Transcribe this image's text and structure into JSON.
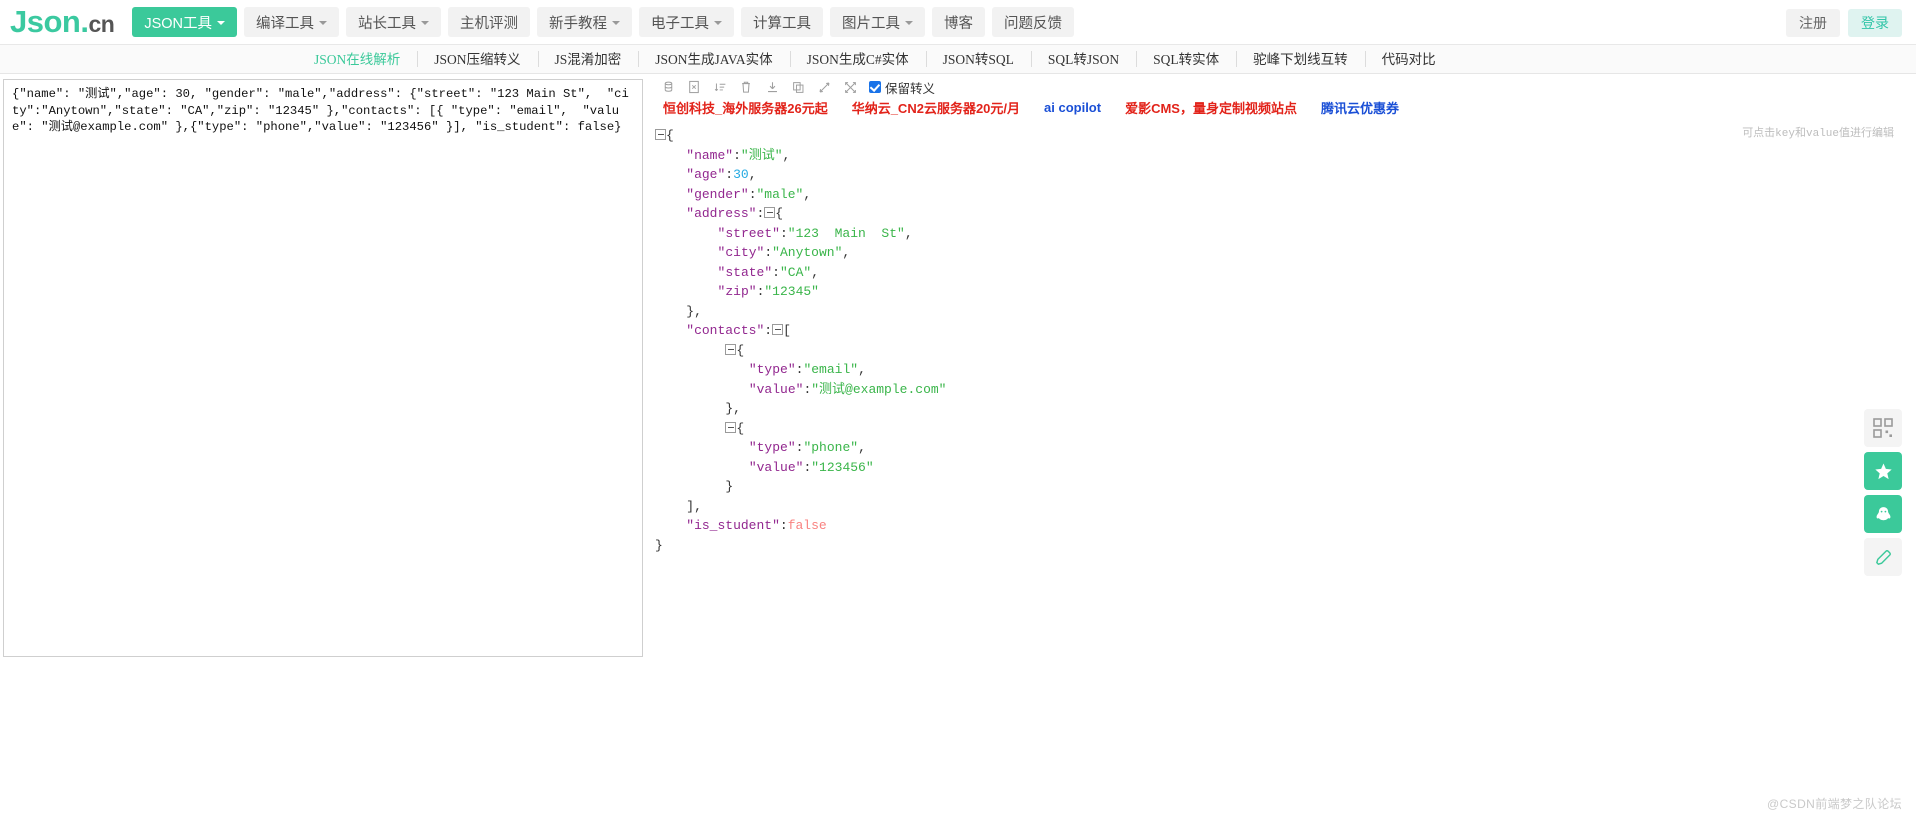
{
  "header": {
    "logo": {
      "json": "Json",
      "dot": ".",
      "cn": "cn"
    },
    "nav_items": [
      {
        "label": "JSON工具",
        "caret": true,
        "active": true
      },
      {
        "label": "编译工具",
        "caret": true,
        "active": false
      },
      {
        "label": "站长工具",
        "caret": true,
        "active": false
      },
      {
        "label": "主机评测",
        "caret": false,
        "active": false
      },
      {
        "label": "新手教程",
        "caret": true,
        "active": false
      },
      {
        "label": "电子工具",
        "caret": true,
        "active": false
      },
      {
        "label": "计算工具",
        "caret": false,
        "active": false
      },
      {
        "label": "图片工具",
        "caret": true,
        "active": false
      },
      {
        "label": "博客",
        "caret": false,
        "active": false
      },
      {
        "label": "问题反馈",
        "caret": false,
        "active": false
      }
    ],
    "register_label": "注册",
    "login_label": "登录"
  },
  "subnav": {
    "items": [
      {
        "label": "JSON在线解析",
        "active": true
      },
      {
        "label": "JSON压缩转义",
        "active": false
      },
      {
        "label": "JS混淆加密",
        "active": false
      },
      {
        "label": "JSON生成JAVA实体",
        "active": false
      },
      {
        "label": "JSON生成C#实体",
        "active": false
      },
      {
        "label": "JSON转SQL",
        "active": false
      },
      {
        "label": "SQL转JSON",
        "active": false
      },
      {
        "label": "SQL转实体",
        "active": false
      },
      {
        "label": "驼峰下划线互转",
        "active": false
      },
      {
        "label": "代码对比",
        "active": false
      }
    ]
  },
  "editor": {
    "value": "{\"name\": \"测试\",\"age\": 30, \"gender\": \"male\",\"address\": {\"street\": \"123 Main St\",  \"city\":\"Anytown\",\"state\": \"CA\",\"zip\": \"12345\" },\"contacts\": [{ \"type\": \"email\",  \"value\": \"测试@example.com\" },{\"type\": \"phone\",\"value\": \"123456\" }], \"is_student\": false}",
    "placeholder": ""
  },
  "toolbar": {
    "icons": [
      {
        "name": "format-icon",
        "title": "格式化"
      },
      {
        "name": "document-icon",
        "title": "校验"
      },
      {
        "name": "sort-icon",
        "title": "排序"
      },
      {
        "name": "delete-icon",
        "title": "清空"
      },
      {
        "name": "download-icon",
        "title": "下载"
      },
      {
        "name": "copy-icon",
        "title": "复制"
      },
      {
        "name": "collapse-icon",
        "title": "折叠"
      },
      {
        "name": "expand-icon",
        "title": "展开"
      }
    ],
    "checkbox_label": "保留转义",
    "checkbox_checked": true
  },
  "ads": {
    "links": [
      {
        "text": "恒创科技_海外服务器26元起",
        "color": "#e2231a"
      },
      {
        "text": "华纳云_CN2云服务器20元/月",
        "color": "#e2231a"
      },
      {
        "text": "ai copilot",
        "color": "#1a4fd6"
      },
      {
        "text": "爱影CMS，量身定制视频站点",
        "color": "#e2231a"
      },
      {
        "text": "腾讯云优惠券",
        "color": "#1a4fd6"
      }
    ]
  },
  "tree": {
    "hint": "可点击key和value值进行编辑",
    "lines": [
      {
        "indent": 0,
        "toggle": true,
        "parts": [
          {
            "t": "{",
            "c": "p"
          }
        ]
      },
      {
        "indent": 4,
        "toggle": false,
        "parts": [
          {
            "t": "\"name\"",
            "c": "k"
          },
          {
            "t": ":",
            "c": "p"
          },
          {
            "t": "\"测试\"",
            "c": "s"
          },
          {
            "t": ",",
            "c": "p"
          }
        ]
      },
      {
        "indent": 4,
        "toggle": false,
        "parts": [
          {
            "t": "\"age\"",
            "c": "k"
          },
          {
            "t": ":",
            "c": "p"
          },
          {
            "t": "30",
            "c": "n"
          },
          {
            "t": ",",
            "c": "p"
          }
        ]
      },
      {
        "indent": 4,
        "toggle": false,
        "parts": [
          {
            "t": "\"gender\"",
            "c": "k"
          },
          {
            "t": ":",
            "c": "p"
          },
          {
            "t": "\"male\"",
            "c": "s"
          },
          {
            "t": ",",
            "c": "p"
          }
        ]
      },
      {
        "indent": 4,
        "toggle": true,
        "toggleAfter": true,
        "parts": [
          {
            "t": "\"address\"",
            "c": "k"
          },
          {
            "t": ":",
            "c": "p"
          }
        ],
        "tail": "{"
      },
      {
        "indent": 8,
        "toggle": false,
        "parts": [
          {
            "t": "\"street\"",
            "c": "k"
          },
          {
            "t": ":",
            "c": "p"
          },
          {
            "t": "\"123  Main  St\"",
            "c": "s"
          },
          {
            "t": ",",
            "c": "p"
          }
        ]
      },
      {
        "indent": 8,
        "toggle": false,
        "parts": [
          {
            "t": "\"city\"",
            "c": "k"
          },
          {
            "t": ":",
            "c": "p"
          },
          {
            "t": "\"Anytown\"",
            "c": "s"
          },
          {
            "t": ",",
            "c": "p"
          }
        ]
      },
      {
        "indent": 8,
        "toggle": false,
        "parts": [
          {
            "t": "\"state\"",
            "c": "k"
          },
          {
            "t": ":",
            "c": "p"
          },
          {
            "t": "\"CA\"",
            "c": "s"
          },
          {
            "t": ",",
            "c": "p"
          }
        ]
      },
      {
        "indent": 8,
        "toggle": false,
        "parts": [
          {
            "t": "\"zip\"",
            "c": "k"
          },
          {
            "t": ":",
            "c": "p"
          },
          {
            "t": "\"12345\"",
            "c": "s"
          }
        ]
      },
      {
        "indent": 4,
        "toggle": false,
        "parts": [
          {
            "t": "},",
            "c": "p"
          }
        ]
      },
      {
        "indent": 4,
        "toggle": true,
        "toggleAfter": true,
        "parts": [
          {
            "t": "\"contacts\"",
            "c": "k"
          },
          {
            "t": ":",
            "c": "p"
          }
        ],
        "tail": "["
      },
      {
        "indent": 9,
        "toggle": true,
        "toggleLead": true,
        "parts": [
          {
            "t": "{",
            "c": "p"
          }
        ]
      },
      {
        "indent": 12,
        "toggle": false,
        "parts": [
          {
            "t": "\"type\"",
            "c": "k"
          },
          {
            "t": ":",
            "c": "p"
          },
          {
            "t": "\"email\"",
            "c": "s"
          },
          {
            "t": ",",
            "c": "p"
          }
        ]
      },
      {
        "indent": 12,
        "toggle": false,
        "parts": [
          {
            "t": "\"value\"",
            "c": "k"
          },
          {
            "t": ":",
            "c": "p"
          },
          {
            "t": "\"测试@example.com\"",
            "c": "s"
          }
        ]
      },
      {
        "indent": 9,
        "toggle": false,
        "parts": [
          {
            "t": "},",
            "c": "p"
          }
        ]
      },
      {
        "indent": 9,
        "toggle": true,
        "toggleLead": true,
        "parts": [
          {
            "t": "{",
            "c": "p"
          }
        ]
      },
      {
        "indent": 12,
        "toggle": false,
        "parts": [
          {
            "t": "\"type\"",
            "c": "k"
          },
          {
            "t": ":",
            "c": "p"
          },
          {
            "t": "\"phone\"",
            "c": "s"
          },
          {
            "t": ",",
            "c": "p"
          }
        ]
      },
      {
        "indent": 12,
        "toggle": false,
        "parts": [
          {
            "t": "\"value\"",
            "c": "k"
          },
          {
            "t": ":",
            "c": "p"
          },
          {
            "t": "\"123456\"",
            "c": "s"
          }
        ]
      },
      {
        "indent": 9,
        "toggle": false,
        "parts": [
          {
            "t": "}",
            "c": "p"
          }
        ]
      },
      {
        "indent": 4,
        "toggle": false,
        "parts": [
          {
            "t": "],",
            "c": "p"
          }
        ]
      },
      {
        "indent": 4,
        "toggle": false,
        "parts": [
          {
            "t": "\"is_student\"",
            "c": "k"
          },
          {
            "t": ":",
            "c": "p"
          },
          {
            "t": "false",
            "c": "b"
          }
        ]
      },
      {
        "indent": 0,
        "toggle": false,
        "parts": [
          {
            "t": "}",
            "c": "p"
          }
        ]
      }
    ]
  },
  "float_buttons": [
    {
      "name": "qrcode-button",
      "glyph": "qr"
    },
    {
      "name": "favorite-button",
      "glyph": "★"
    },
    {
      "name": "qq-button",
      "glyph": "qq"
    },
    {
      "name": "feedback-button",
      "glyph": "✎"
    }
  ],
  "watermark": "@CSDN前端梦之队论坛"
}
